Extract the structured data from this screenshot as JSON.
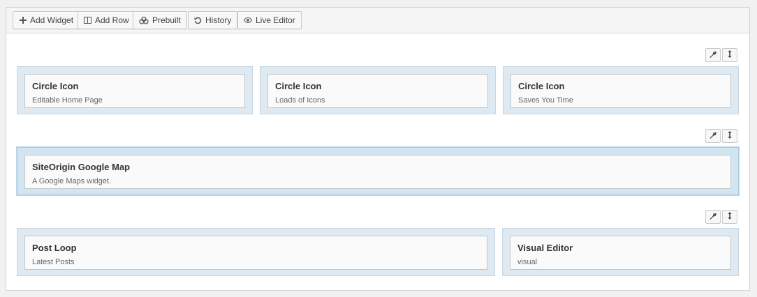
{
  "toolbar": {
    "buttons": [
      {
        "label": "Add Widget",
        "icon": "plus-icon"
      },
      {
        "label": "Add Row",
        "icon": "columns-icon"
      },
      {
        "label": "Prebuilt",
        "icon": "layers-icon"
      },
      {
        "label": "History",
        "icon": "history-icon"
      },
      {
        "label": "Live Editor",
        "icon": "eye-icon"
      }
    ]
  },
  "rows": [
    {
      "cells": [
        {
          "title": "Circle Icon",
          "desc": "Editable Home Page"
        },
        {
          "title": "Circle Icon",
          "desc": "Loads of Icons"
        },
        {
          "title": "Circle Icon",
          "desc": "Saves You Time"
        }
      ]
    },
    {
      "cells": [
        {
          "title": "SiteOrigin Google Map",
          "desc": "A Google Maps widget."
        }
      ]
    },
    {
      "cells": [
        {
          "title": "Post Loop",
          "desc": "Latest Posts"
        },
        {
          "title": "Visual Editor",
          "desc": "visual"
        }
      ]
    }
  ],
  "colors": {
    "cell_bg": "#dfe9f1",
    "active_cell_bg": "#d2e5f0",
    "widget_border": "#bfc7cc"
  }
}
